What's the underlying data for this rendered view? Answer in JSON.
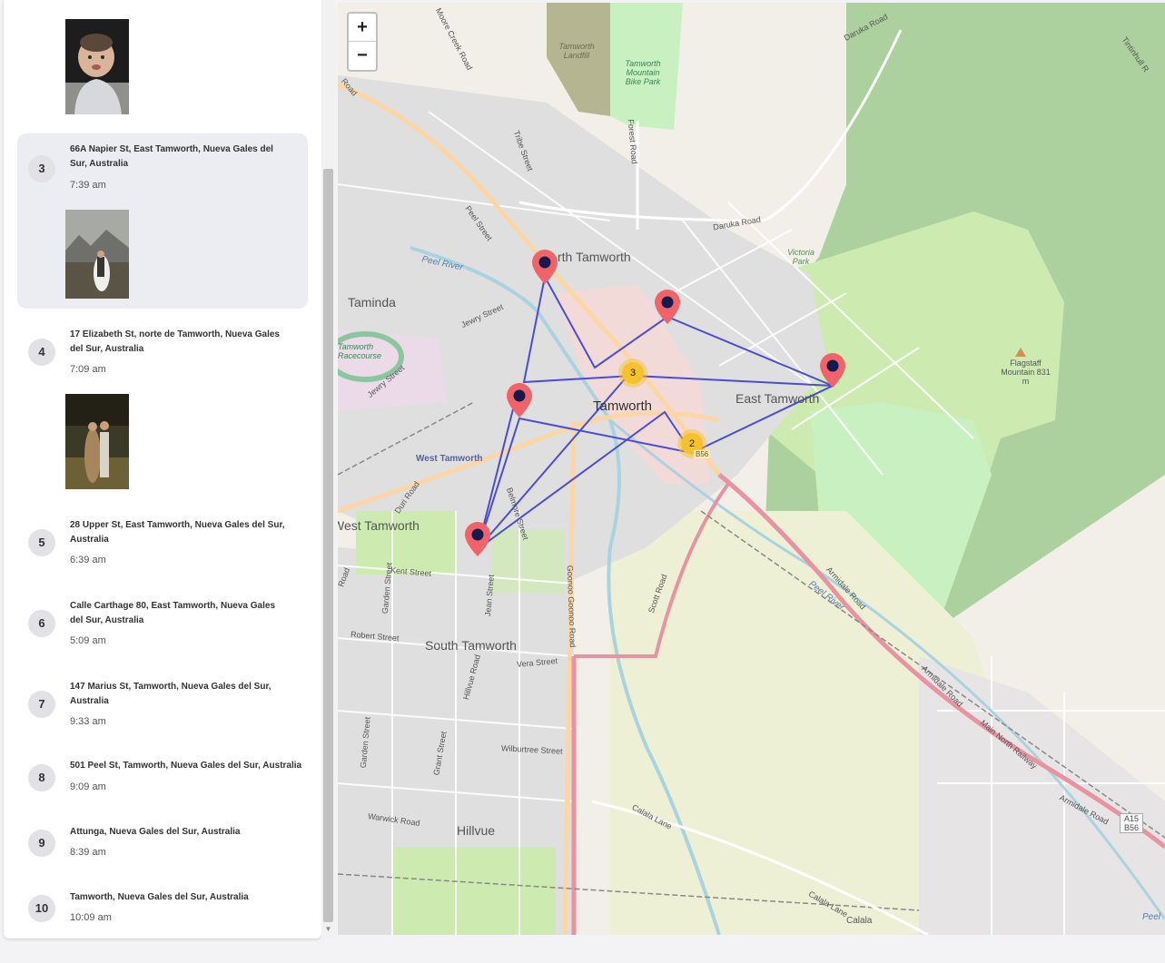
{
  "sidebar": {
    "stops": [
      {
        "number": "3",
        "address": "66A Napier St, East Tamworth, Nueva Gales del Sur, Australia",
        "time": "7:39 am"
      },
      {
        "number": "4",
        "address": "17 Elizabeth St, norte de Tamworth, Nueva Gales del Sur, Australia",
        "time": "7:09 am"
      },
      {
        "number": "5",
        "address": "28 Upper St, East Tamworth, Nueva Gales del Sur, Australia",
        "time": "6:39 am"
      },
      {
        "number": "6",
        "address": "Calle Carthage 80, East Tamworth, Nueva Gales del Sur, Australia",
        "time": "5:09 am"
      },
      {
        "number": "7",
        "address": "147 Marius St, Tamworth, Nueva Gales del Sur, Australia",
        "time": "9:33 am"
      },
      {
        "number": "8",
        "address": "501 Peel St, Tamworth, Nueva Gales del Sur, Australia",
        "time": "9:09 am"
      },
      {
        "number": "9",
        "address": "Attunga, Nueva Gales del Sur, Australia",
        "time": "8:39 am"
      },
      {
        "number": "10",
        "address": "Tamworth, Nueva Gales del Sur, Australia",
        "time": "10:09 am"
      }
    ]
  },
  "map": {
    "zoom_in": "+",
    "zoom_out": "−",
    "clusters": [
      "3",
      "2"
    ],
    "labels": {
      "north_tamworth": "rth Tamworth",
      "tamworth": "Tamworth",
      "east_tamworth": "East Tamworth",
      "taminda": "Taminda",
      "west_tamworth": "West Tamworth",
      "west_tamworth_big": "West Tamworth",
      "south_tamworth": "South Tamworth",
      "hillvue": "Hillvue",
      "peel_river": "Peel River",
      "peel_river_2": "Peel River",
      "peel_street": "Peel Street",
      "jewry_street": "Jewry Street",
      "jewry_street_2": "Jewry Street",
      "daruka_road": "Daruka Road",
      "daruka_road_2": "Daruka Road",
      "victoria_park": "Victoria Park",
      "flagstaff": "Flagstaff Mountain 831 m",
      "racecourse": "Tamworth Racecourse",
      "landfill": "Tamworth Landfill",
      "bike_park": "Tamworth Mountain Bike Park",
      "moore_creek": "Moore Creek Road",
      "tribe_street": "Tribe Street",
      "forest_road": "Forest Road",
      "kent_street": "Kent Street",
      "robert_street": "Robert Street",
      "vera_street": "Vera Street",
      "wilburtree": "Wilburtree Street",
      "warwick_road": "Warwick Road",
      "calala_lane": "Calala Lane",
      "calala_lane_2": "Calala Lane",
      "calala": "Calala",
      "armidale_road": "Armidale Road",
      "armidale_road_2": "Armidale Road",
      "armidale_road_3": "Armidale Road",
      "main_north_railway": "Main North Railway",
      "scott_road": "Scott Road",
      "goonoo_road": "Goonoo Goonoo Road",
      "belmore_street": "Belmore Street",
      "jean_street": "Jean Street",
      "hillvue_road": "Hillvue Road",
      "garden_street": "Garden Street",
      "garden_street_2": "Garden Street",
      "grant_street": "Grant Street",
      "duri_road": "Duri Road",
      "tintinhull": "Tintinhull R",
      "b56": "B56",
      "a15_b56": "A15 B56",
      "peel_edge": "Peel",
      "road_edge": "Road",
      "road_edge_2": "Road"
    }
  }
}
